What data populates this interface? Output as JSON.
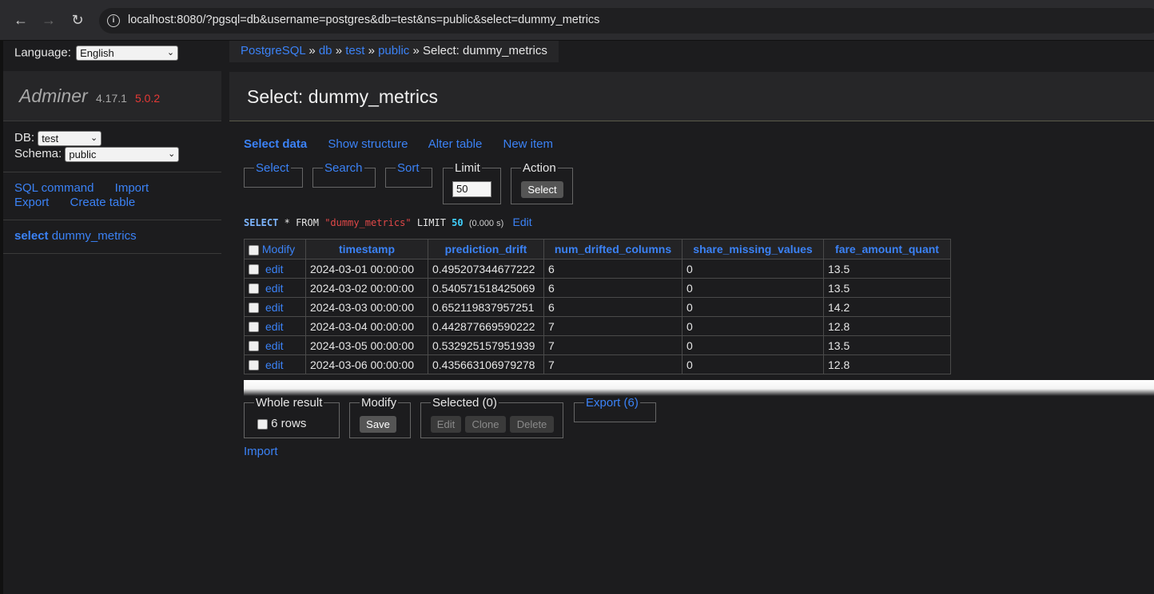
{
  "browser": {
    "url": "localhost:8080/?pgsql=db&username=postgres&db=test&ns=public&select=dummy_metrics",
    "back_icon": "arrow-left-icon",
    "forward_icon": "arrow-right-icon",
    "reload_icon": "reload-icon",
    "info_icon": "info-icon"
  },
  "sidebar": {
    "language_label": "Language:",
    "language_value": "English",
    "logo_name": "Adminer",
    "logo_version": "4.17.1",
    "logo_new_version": "5.0.2",
    "db_label": "DB:",
    "db_value": "test",
    "schema_label": "Schema:",
    "schema_value": "public",
    "links": {
      "sql_command": "SQL command",
      "import": "Import",
      "export": "Export",
      "create_table": "Create table"
    },
    "table_item": {
      "prefix": "select",
      "name": "dummy_metrics"
    }
  },
  "breadcrumb": {
    "items": [
      "PostgreSQL",
      "db",
      "test",
      "public"
    ],
    "separator": "»",
    "current": "Select: dummy_metrics"
  },
  "page_title": "Select: dummy_metrics",
  "tabs": [
    "Select data",
    "Show structure",
    "Alter table",
    "New item"
  ],
  "filters": {
    "select": "Select",
    "search": "Search",
    "sort": "Sort",
    "limit_label": "Limit",
    "limit_value": "50",
    "action_label": "Action",
    "action_button": "Select"
  },
  "query": {
    "select_kw": "SELECT",
    "star": "*",
    "from_kw": "FROM",
    "table": "\"dummy_metrics\"",
    "limit_kw": "LIMIT",
    "limit_value": "50",
    "time": "(0.000 s)",
    "edit": "Edit"
  },
  "table": {
    "modify_header": "Modify",
    "columns": [
      "timestamp",
      "prediction_drift",
      "num_drifted_columns",
      "share_missing_values",
      "fare_amount_quant"
    ],
    "edit_label": "edit",
    "rows": [
      [
        "2024-03-01 00:00:00",
        "0.495207344677222",
        "6",
        "0",
        "13.5"
      ],
      [
        "2024-03-02 00:00:00",
        "0.540571518425069",
        "6",
        "0",
        "13.5"
      ],
      [
        "2024-03-03 00:00:00",
        "0.652119837957251",
        "6",
        "0",
        "14.2"
      ],
      [
        "2024-03-04 00:00:00",
        "0.442877669590222",
        "7",
        "0",
        "12.8"
      ],
      [
        "2024-03-05 00:00:00",
        "0.532925157951939",
        "7",
        "0",
        "13.5"
      ],
      [
        "2024-03-06 00:00:00",
        "0.435663106979278",
        "7",
        "0",
        "12.8"
      ]
    ]
  },
  "footer": {
    "whole_result_label": "Whole result",
    "rows_count": "6 rows",
    "modify_label": "Modify",
    "save_button": "Save",
    "selected_label": "Selected (0)",
    "edit_button": "Edit",
    "clone_button": "Clone",
    "delete_button": "Delete",
    "export_label": "Export (6)",
    "import_link": "Import"
  }
}
